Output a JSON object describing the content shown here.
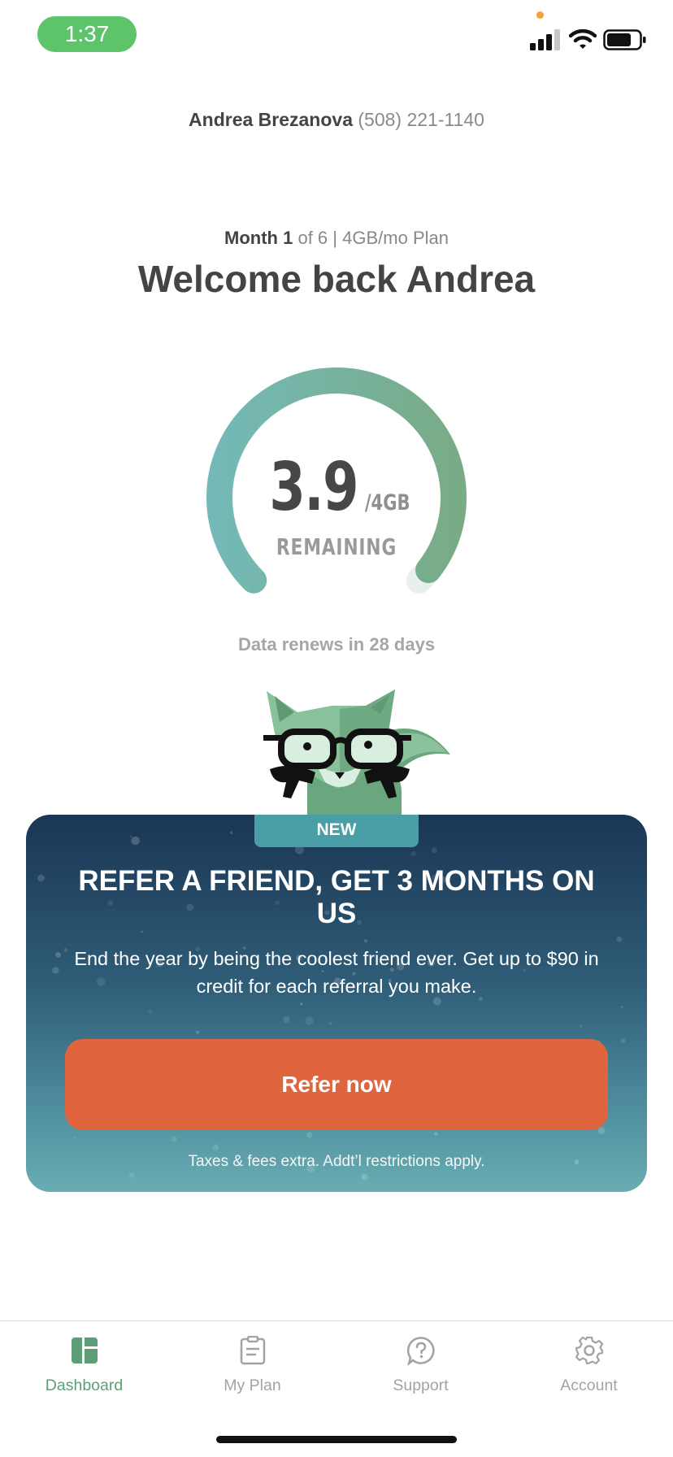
{
  "status_bar": {
    "time": "1:37"
  },
  "header": {
    "user_name": "Andrea Brezanova",
    "phone": "(508) 221-1140"
  },
  "plan": {
    "month_label": "Month 1",
    "of_total": "of 6",
    "separator": "|",
    "plan_name": "4GB/mo Plan"
  },
  "welcome_title": "Welcome back Andrea",
  "data_gauge": {
    "remaining_value": "3.9",
    "unit": "/4GB",
    "label": "REMAINING",
    "remaining_fraction": 0.975,
    "colors": {
      "track": "#e8f0ec",
      "arc_start": "#74b9b7",
      "arc_end": "#79ab86"
    }
  },
  "renew_text": "Data renews in 28 days",
  "promo": {
    "badge": "NEW",
    "title": "REFER A FRIEND, GET 3 MONTHS ON US",
    "body": "End the year by being the coolest friend ever. Get up to $90 in credit for each referral you make.",
    "button_label": "Refer now",
    "footnote": "Taxes & fees extra. Addt’l restrictions apply.",
    "colors": {
      "button": "#e0653f",
      "gradient_top": "#1a3654",
      "gradient_bottom": "#6aadb2"
    }
  },
  "tab_bar": {
    "tabs": [
      {
        "label": "Dashboard",
        "icon": "dashboard-icon",
        "active": true
      },
      {
        "label": "My Plan",
        "icon": "clipboard-icon",
        "active": false
      },
      {
        "label": "Support",
        "icon": "question-icon",
        "active": false
      },
      {
        "label": "Account",
        "icon": "gear-icon",
        "active": false
      }
    ],
    "active_color": "#5d9e76",
    "inactive_color": "#a3a3a3"
  }
}
